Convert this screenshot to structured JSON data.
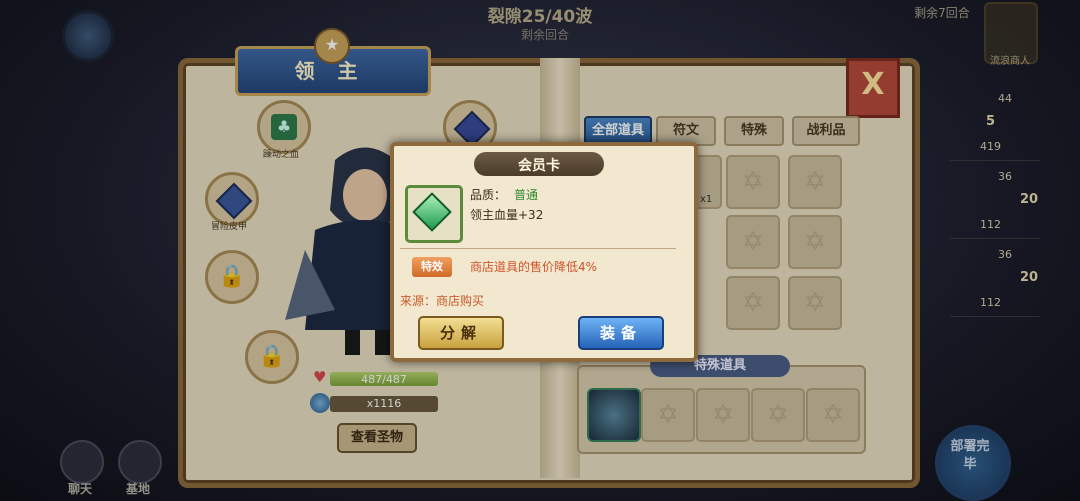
{
  "hud": {
    "wave_text": "裂隙25/40波",
    "round_left": "剩余回合",
    "round_right": "剩余7回合",
    "merchant_label": "流浪商人"
  },
  "side_list": [
    {
      "top": "44",
      "mid": "5",
      "bottom": "419"
    },
    {
      "top": "36",
      "mid": "20",
      "bottom": "112"
    },
    {
      "top": "36",
      "mid": "20",
      "bottom": "112"
    }
  ],
  "panel": {
    "title": "领 主",
    "close_label": "X",
    "left_slots": [
      {
        "label": "躁动之血",
        "icon": "clover-gem-icon"
      },
      {
        "label": "冒险皮甲",
        "icon": "armor-icon"
      }
    ],
    "hp_text": "487/487",
    "hp_fraction": 1.0,
    "gold_text": "x1116",
    "view_relics_label": "查看圣物",
    "tabs": [
      {
        "label": "全部道具",
        "active": true
      },
      {
        "label": "符文",
        "active": false
      },
      {
        "label": "特殊",
        "active": false
      },
      {
        "label": "战利品",
        "active": false
      }
    ],
    "first_cell_count": "x1",
    "special_header": "特殊道具"
  },
  "popup": {
    "title": "会员卡",
    "quality_label": "品质：",
    "quality_value": "普通",
    "stat_text": "领主血量+32",
    "effect_badge": "特效",
    "effect_text": "商店道具的售价降低4%",
    "source_text": "来源：商店购买",
    "split_button": "分解",
    "equip_button": "装备"
  },
  "bottom_left": {
    "chat_label": "聊天",
    "base_label": "基地"
  },
  "deploy": {
    "label": "部署完毕"
  },
  "colors": {
    "accent_blue": "#2a5d9a",
    "book_parchment": "#e8ddc1",
    "rarity_green": "#2f8a2f",
    "effect_orange": "#d0532a"
  }
}
